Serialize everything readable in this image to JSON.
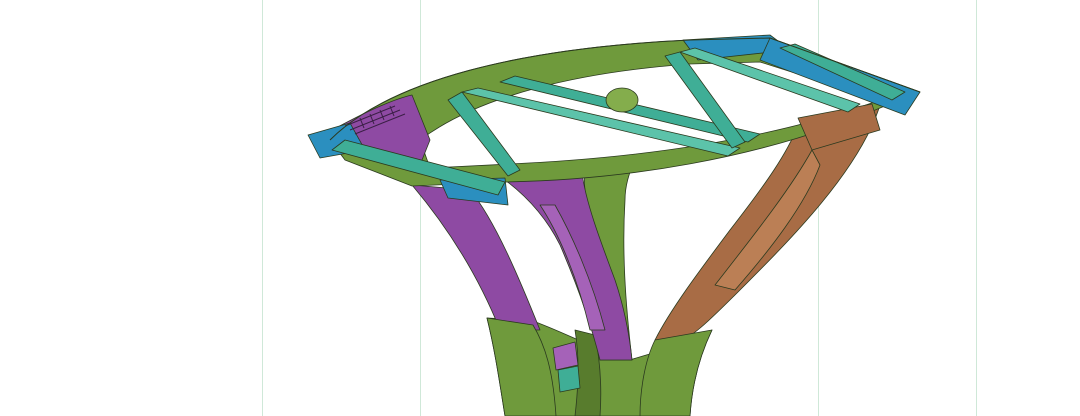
{
  "viewport": {
    "background": "#ffffff",
    "guide_color": "#cfe8d8"
  },
  "model": {
    "colors": {
      "green": "#6f9a3c",
      "green_dark": "#587c2d",
      "green_light": "#84ad4c",
      "teal": "#3fae96",
      "teal_light": "#5cc3aa",
      "blue": "#2b8fbf",
      "blue_light": "#3aa2cf",
      "purple": "#8e4aa3",
      "purple_light": "#a562b8",
      "orange": "#a86c45",
      "orange_light": "#bb7f55",
      "edge": "#2b3a1f"
    }
  }
}
